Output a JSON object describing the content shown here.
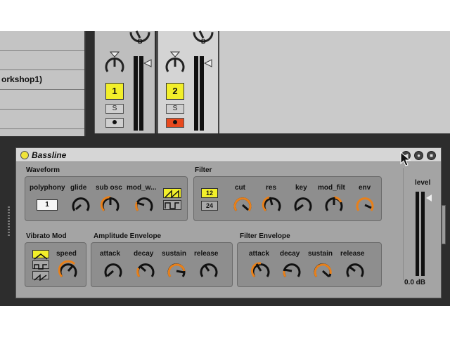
{
  "browser": {
    "items": [
      "",
      "",
      "orkshop1)",
      "",
      ""
    ]
  },
  "tracks": [
    {
      "number": "1",
      "send_label": "B",
      "solo": "S"
    },
    {
      "number": "2",
      "send_label": "B",
      "solo": "S"
    }
  ],
  "device": {
    "name": "Bassline",
    "waveform": {
      "title": "Waveform",
      "polyphony_label": "polyphony",
      "polyphony_value": "1",
      "glide_label": "glide",
      "sub_osc_label": "sub osc",
      "mod_w_label": "mod_w..."
    },
    "filter": {
      "title": "Filter",
      "option_12": "12",
      "option_24": "24",
      "cutoff_label": "cut",
      "res_label": "res",
      "key_label": "key",
      "mod_filt_label": "mod_filt",
      "env_label": "env"
    },
    "vibrato": {
      "title": "Vibrato Mod",
      "speed_label": "speed"
    },
    "amp_env": {
      "title": "Amplitude Envelope",
      "attack_label": "attack",
      "decay_label": "decay",
      "sustain_label": "sustain",
      "release_label": "release"
    },
    "filter_env": {
      "title": "Filter Envelope",
      "attack_label": "attack",
      "decay_label": "decay",
      "sustain_label": "sustain",
      "release_label": "release"
    },
    "level": {
      "label": "level",
      "value": "0.0 dB"
    }
  },
  "colors": {
    "accent_yellow": "#f2ef2a",
    "knob_orange": "#e8801a",
    "record_red": "#e8491d"
  }
}
